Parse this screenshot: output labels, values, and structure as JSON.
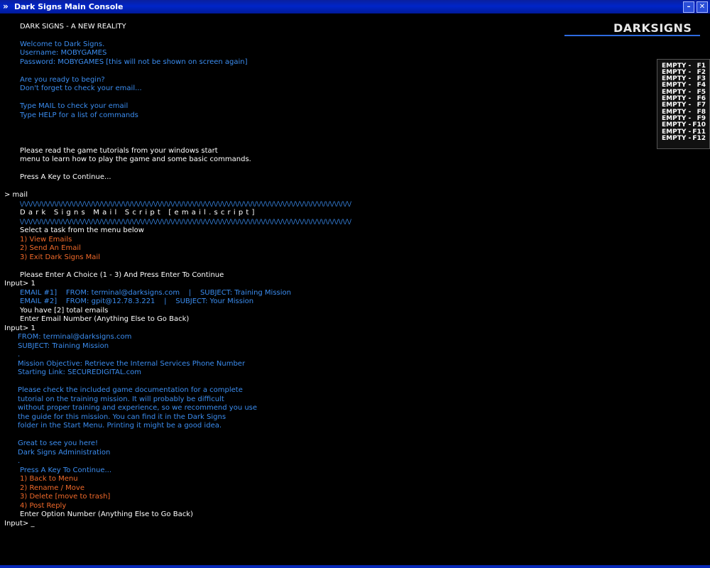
{
  "window": {
    "title": "Dark Signs Main Console",
    "minimize_label": "–",
    "close_label": "✕"
  },
  "logo": {
    "text": "DARKSIGNS"
  },
  "fkeys": [
    {
      "label": "EMPTY -",
      "key": "F1"
    },
    {
      "label": "EMPTY -",
      "key": "F2"
    },
    {
      "label": "EMPTY -",
      "key": "F3"
    },
    {
      "label": "EMPTY -",
      "key": "F4"
    },
    {
      "label": "EMPTY -",
      "key": "F5"
    },
    {
      "label": "EMPTY -",
      "key": "F6"
    },
    {
      "label": "EMPTY -",
      "key": "F7"
    },
    {
      "label": "EMPTY -",
      "key": "F8"
    },
    {
      "label": "EMPTY -",
      "key": "F9"
    },
    {
      "label": "EMPTY -",
      "key": "F10"
    },
    {
      "label": "EMPTY -",
      "key": "F11"
    },
    {
      "label": "EMPTY -",
      "key": "F12"
    }
  ],
  "console": {
    "heading": "DARK SIGNS - A NEW REALITY",
    "welcome": "Welcome to Dark Signs.",
    "username": "Username: MOBYGAMES",
    "password": "Password: MOBYGAMES [this will not be shown on screen again]",
    "ready": "Are you ready to begin?",
    "check_email": "Don't forget to check your email...",
    "type_mail": "Type MAIL to check your email",
    "type_help": "Type HELP for a list of commands",
    "tutorial_1": "Please read the game tutorials from your windows start",
    "tutorial_2": "menu to learn how to play the game and some basic commands.",
    "press_key": "Press A Key to Continue...",
    "cmd_mail": "> mail",
    "sep_1": "\\/\\/\\/\\/\\/\\/\\/\\/\\/\\/\\/\\/\\/\\/\\/\\/\\/\\/\\/\\/\\/\\/\\/\\/\\/\\/\\/\\/\\/\\/\\/\\/\\/\\/\\/\\/\\/\\/\\/\\/\\/\\/\\/\\/\\/\\/\\/\\/\\/\\/\\/\\/\\/\\/\\/\\/\\/\\/\\/\\/\\/\\/\\/\\/\\/\\/\\/\\/\\/\\/\\/\\/\\/\\/\\/\\/\\/",
    "mail_script": "Dark Signs Mail Script [email.script]",
    "sep_2": "\\/\\/\\/\\/\\/\\/\\/\\/\\/\\/\\/\\/\\/\\/\\/\\/\\/\\/\\/\\/\\/\\/\\/\\/\\/\\/\\/\\/\\/\\/\\/\\/\\/\\/\\/\\/\\/\\/\\/\\/\\/\\/\\/\\/\\/\\/\\/\\/\\/\\/\\/\\/\\/\\/\\/\\/\\/\\/\\/\\/\\/\\/\\/\\/\\/\\/\\/\\/\\/\\/\\/\\/\\/\\/\\/\\/\\/",
    "select_task": "Select a task from the menu below",
    "menu_1": "1) View Emails",
    "menu_2": "2) Send An Email",
    "menu_3": "3) Exit Dark Signs Mail",
    "enter_choice": "Please Enter A Choice (1 - 3) And Press Enter To Continue",
    "input_1": "Input> 1",
    "email_1": "EMAIL #1]    FROM: terminal@darksigns.com    |    SUBJECT: Training Mission",
    "email_2": "EMAIL #2]    FROM: gpit@12.78.3.221    |    SUBJECT: Your Mission",
    "total_emails": "You have [2] total emails",
    "enter_email_number": "Enter Email Number (Anything Else to Go Back)",
    "input_2": "Input> 1",
    "from": "FROM: terminal@darksigns.com",
    "subject": "SUBJECT: Training Mission",
    "dot_1": ".",
    "objective": "Mission Objective: Retrieve the Internal Services Phone Number",
    "starting_link": "Starting Link: SECUREDIGITAL.com",
    "body_1": "Please check the included game documentation for a complete",
    "body_2": "tutorial on the training mission. It will probably be difficult",
    "body_3": "without proper training and experience, so we recommend you use",
    "body_4": "the guide for this mission. You can find it in the Dark Signs",
    "body_5": "folder in the Start Menu. Printing it might be a good idea.",
    "great": "Great to see you here!",
    "admin": "Dark Signs Administration",
    "dot_2": ".",
    "press_continue": "Press A Key To Continue...",
    "opt_1": "1) Back to Menu",
    "opt_2": "2) Rename / Move",
    "opt_3": "3) Delete [move to trash]",
    "opt_4": "4) Post Reply",
    "enter_option": "Enter Option Number (Anything Else to Go Back)",
    "input_prompt": "Input> _"
  },
  "colors": {
    "title_bar": "#0025c8",
    "text_white": "#ffffff",
    "text_blue": "#3b8df0",
    "text_orange": "#f26a2a",
    "background": "#000000"
  }
}
